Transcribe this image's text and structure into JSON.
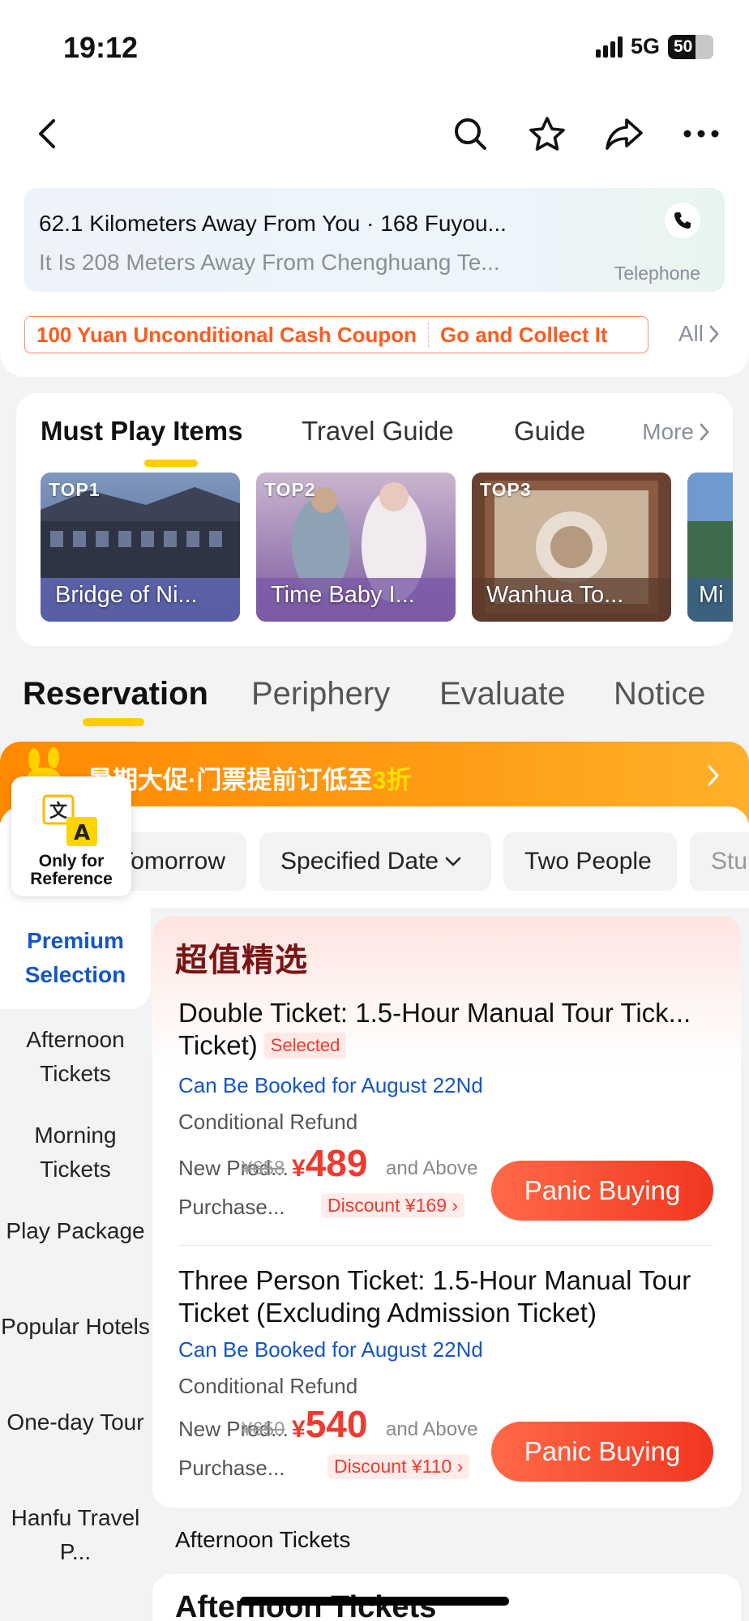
{
  "status_bar": {
    "time": "19:12",
    "network": "5G",
    "battery": "50"
  },
  "location": {
    "line1": "62.1 Kilometers Away From You · 168 Fuyou...",
    "line2": "It Is 208 Meters Away From Chenghuang Te...",
    "telephone_label": "Telephone"
  },
  "coupon": {
    "text1": "100 Yuan Unconditional Cash Coupon",
    "text2": "Go and Collect It",
    "all_label": "All"
  },
  "must_play": {
    "tabs": [
      "Must Play Items",
      "Travel Guide",
      "Guide"
    ],
    "more_label": "More",
    "items": [
      {
        "rank": "TOP1",
        "name": "Bridge of Ni..."
      },
      {
        "rank": "TOP2",
        "name": "Time Baby I..."
      },
      {
        "rank": "TOP3",
        "name": "Wanhua To..."
      },
      {
        "rank": "",
        "name": "Mi"
      }
    ]
  },
  "main_tabs": [
    "Reservation",
    "Periphery",
    "Evaluate",
    "Notice"
  ],
  "promo": {
    "text": "暑期大促·门票提前订低至",
    "highlight": "3折"
  },
  "translate_badge": {
    "label": "Only for Reference"
  },
  "filters": [
    "Tomorrow",
    "Specified Date",
    "Two People",
    "Stu"
  ],
  "side_nav": [
    "Premium Selection",
    "Afternoon Tickets",
    "Morning Tickets",
    "Play Package",
    "Popular Hotels",
    "One-day Tour",
    "Hanfu Travel P..."
  ],
  "section": {
    "title": "超值精选",
    "items": [
      {
        "title": "Double Ticket: 1.5-Hour Manual Tour Tick... Ticket)",
        "selected_label": "Selected",
        "booking": "Can Be Booked for August 22Nd",
        "refund": "Conditional Refund",
        "new_prod": "New Prod...",
        "purchase": "Purchase...",
        "old_price": "¥658",
        "currency": "¥",
        "price": "489",
        "and_above": "and Above",
        "discount": "Discount ¥169",
        "button": "Panic Buying"
      },
      {
        "title": "Three Person Ticket: 1.5-Hour Manual Tour Ticket (Excluding Admission Ticket)",
        "booking": "Can Be Booked for August 22Nd",
        "refund": "Conditional Refund",
        "new_prod": "New Prod...",
        "purchase": "Purchase...",
        "old_price": "¥650",
        "currency": "¥",
        "price": "540",
        "and_above": "and Above",
        "discount": "Discount ¥110",
        "button": "Panic Buying"
      }
    ]
  },
  "next_section": {
    "label": "Afternoon Tickets",
    "title": "Afternoon Tickets"
  },
  "colors": {
    "accent_yellow": "#ffcc00",
    "price_red": "#f03a2e",
    "link_blue": "#1456c8",
    "promo_orange": "#ff8a00"
  }
}
